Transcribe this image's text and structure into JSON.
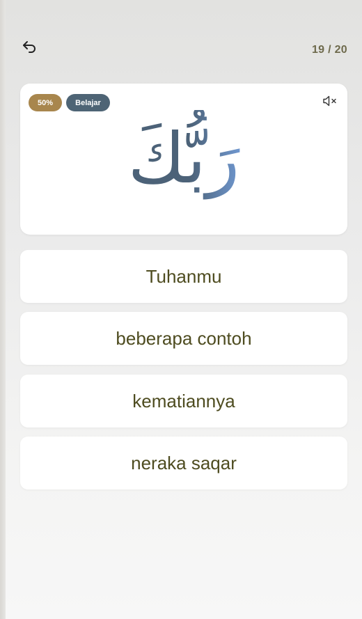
{
  "header": {
    "back_icon": "undo-arrow-icon",
    "progress": "19 / 20"
  },
  "card": {
    "percent_badge": "50%",
    "mode_badge": "Belajar",
    "mute_icon": "speaker-muted-icon",
    "arabic_word": "رَبُّكَ",
    "colors": {
      "percent_badge": "#a8864d",
      "mode_badge": "#4e6475",
      "arabic_dark": "#4c6278",
      "arabic_light": "#6f97cf"
    }
  },
  "options": [
    {
      "label": "Tuhanmu"
    },
    {
      "label": "beberapa contoh"
    },
    {
      "label": "kematiannya"
    },
    {
      "label": "neraka saqar"
    }
  ]
}
